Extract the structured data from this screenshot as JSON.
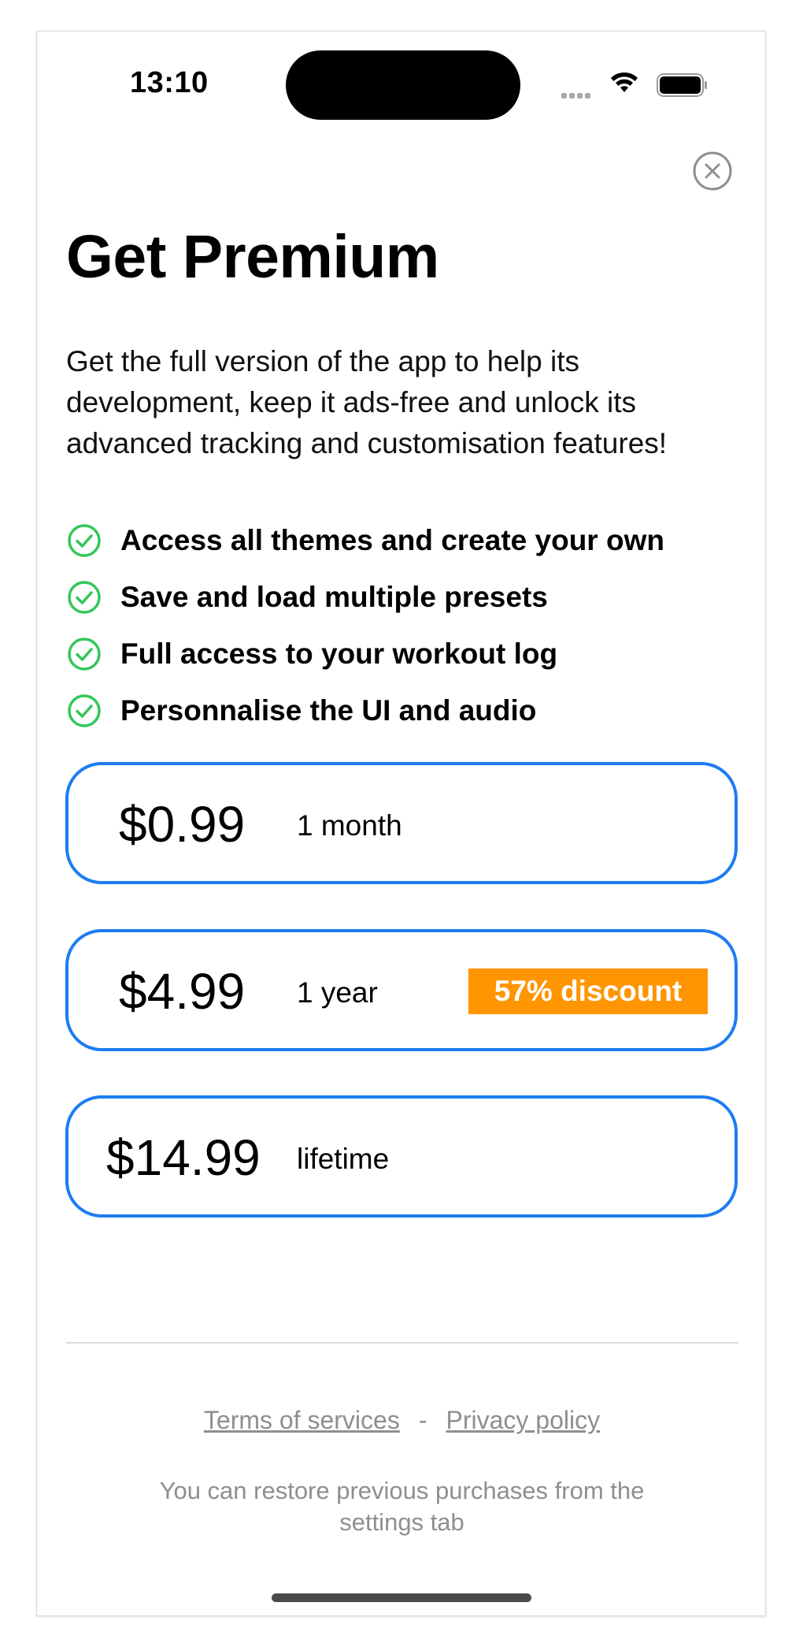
{
  "status_bar": {
    "time": "13:10",
    "icons": [
      "signal-dots-icon",
      "wifi-icon",
      "battery-icon"
    ]
  },
  "header": {
    "close_icon": "close-circle-icon",
    "title": "Get Premium"
  },
  "description": "Get the full version of the app to help its development, keep it ads-free and unlock its advanced tracking and customisation features!",
  "features": [
    {
      "icon": "check-circle-icon",
      "label": "Access all themes and create your own"
    },
    {
      "icon": "check-circle-icon",
      "label": "Save and load multiple presets"
    },
    {
      "icon": "check-circle-icon",
      "label": "Full access to your workout log"
    },
    {
      "icon": "check-circle-icon",
      "label": "Personnalise the UI and audio"
    }
  ],
  "plans": [
    {
      "price": "$0.99",
      "period": "1 month"
    },
    {
      "price": "$4.99",
      "period": "1 year",
      "badge": "57% discount"
    },
    {
      "price": "$14.99",
      "period": "lifetime"
    }
  ],
  "footer": {
    "terms_label": "Terms of services",
    "separator": "-",
    "privacy_label": "Privacy policy",
    "restore_note": "You can restore previous purchases from the settings tab"
  },
  "colors": {
    "accent": "#1d7cf2",
    "badge": "#ff9500",
    "check": "#34c759",
    "muted_text": "#8e8e93"
  }
}
